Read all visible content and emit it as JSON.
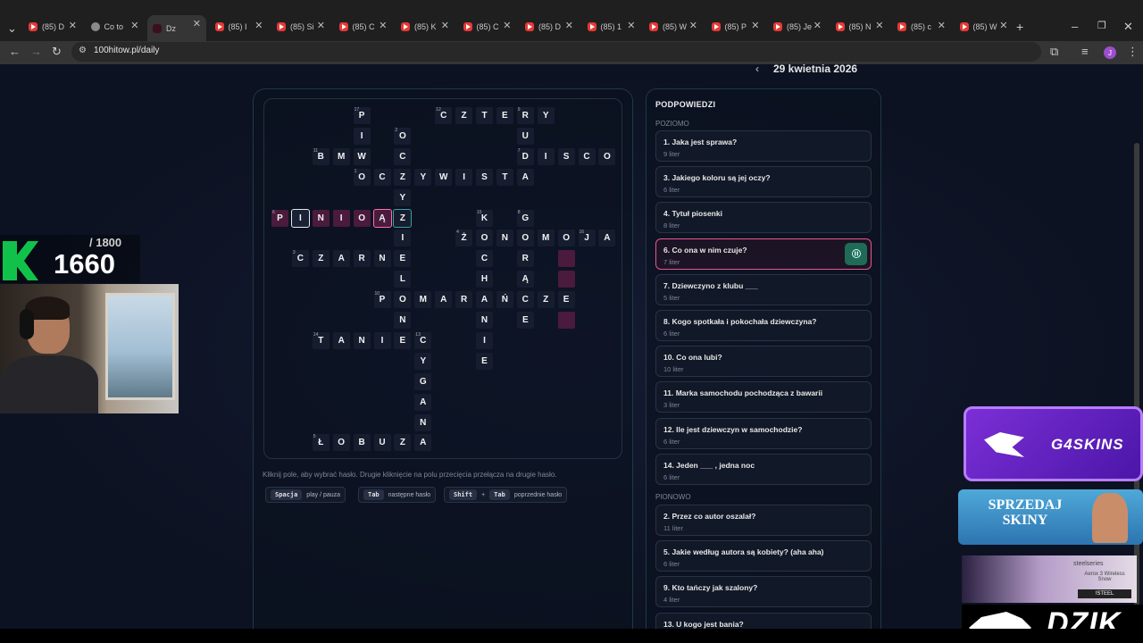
{
  "browser": {
    "tabs": [
      {
        "title": "(85) D",
        "icon": "youtube-icon"
      },
      {
        "title": "Co to",
        "icon": "globe-icon"
      },
      {
        "title": "Dz",
        "icon": "site-icon",
        "active": true
      },
      {
        "title": "(85) I",
        "icon": "youtube-icon"
      },
      {
        "title": "(85) Si",
        "icon": "youtube-icon"
      },
      {
        "title": "(85) C",
        "icon": "youtube-icon"
      },
      {
        "title": "(85) K",
        "icon": "youtube-icon"
      },
      {
        "title": "(85) C",
        "icon": "youtube-icon"
      },
      {
        "title": "(85) D",
        "icon": "youtube-icon"
      },
      {
        "title": "(85) 1",
        "icon": "youtube-icon"
      },
      {
        "title": "(85) W",
        "icon": "youtube-icon"
      },
      {
        "title": "(85) P",
        "icon": "youtube-icon"
      },
      {
        "title": "(85) Je",
        "icon": "youtube-icon"
      },
      {
        "title": "(85) N",
        "icon": "youtube-icon"
      },
      {
        "title": "(85) c",
        "icon": "youtube-icon"
      },
      {
        "title": "(85) W",
        "icon": "youtube-icon"
      }
    ],
    "url": "100hitow.pl/daily",
    "profile_initial": "J"
  },
  "header": {
    "date": "29 kwietnia 2026"
  },
  "crossword": {
    "cells": [
      {
        "c": "P",
        "r": 0,
        "col": 4,
        "n": "17"
      },
      {
        "c": "C",
        "r": 0,
        "col": 8,
        "n": "12"
      },
      {
        "c": "Z",
        "r": 0,
        "col": 9
      },
      {
        "c": "T",
        "r": 0,
        "col": 10
      },
      {
        "c": "E",
        "r": 0,
        "col": 11
      },
      {
        "c": "R",
        "r": 0,
        "col": 12,
        "n": "9"
      },
      {
        "c": "Y",
        "r": 0,
        "col": 13
      },
      {
        "c": "I",
        "r": 1,
        "col": 4
      },
      {
        "c": "O",
        "r": 1,
        "col": 6,
        "n": "2"
      },
      {
        "c": "U",
        "r": 1,
        "col": 12
      },
      {
        "c": "B",
        "r": 2,
        "col": 2,
        "n": "11"
      },
      {
        "c": "M",
        "r": 2,
        "col": 3
      },
      {
        "c": "W",
        "r": 2,
        "col": 4
      },
      {
        "c": "C",
        "r": 2,
        "col": 6
      },
      {
        "c": "D",
        "r": 2,
        "col": 12,
        "n": "7"
      },
      {
        "c": "I",
        "r": 2,
        "col": 13
      },
      {
        "c": "S",
        "r": 2,
        "col": 14
      },
      {
        "c": "C",
        "r": 2,
        "col": 15
      },
      {
        "c": "O",
        "r": 2,
        "col": 16
      },
      {
        "c": "O",
        "r": 3,
        "col": 4,
        "n": "1"
      },
      {
        "c": "C",
        "r": 3,
        "col": 5
      },
      {
        "c": "Z",
        "r": 3,
        "col": 6
      },
      {
        "c": "Y",
        "r": 3,
        "col": 7
      },
      {
        "c": "W",
        "r": 3,
        "col": 8
      },
      {
        "c": "I",
        "r": 3,
        "col": 9
      },
      {
        "c": "S",
        "r": 3,
        "col": 10
      },
      {
        "c": "T",
        "r": 3,
        "col": 11
      },
      {
        "c": "A",
        "r": 3,
        "col": 12
      },
      {
        "c": "Y",
        "r": 4,
        "col": 6
      },
      {
        "c": "P",
        "r": 5,
        "col": 0,
        "n": "6",
        "s": "hl"
      },
      {
        "c": "I",
        "r": 5,
        "col": 1,
        "s": "sel"
      },
      {
        "c": "N",
        "r": 5,
        "col": 2,
        "s": "hl"
      },
      {
        "c": "I",
        "r": 5,
        "col": 3,
        "s": "hl"
      },
      {
        "c": "O",
        "r": 5,
        "col": 4,
        "s": "hl"
      },
      {
        "c": "Ą",
        "r": 5,
        "col": 5,
        "s": "hlsel"
      },
      {
        "c": "Z",
        "r": 5,
        "col": 6,
        "s": "cross"
      },
      {
        "c": "K",
        "r": 5,
        "col": 10,
        "n": "15"
      },
      {
        "c": "G",
        "r": 5,
        "col": 12,
        "n": "8"
      },
      {
        "c": "I",
        "r": 6,
        "col": 6
      },
      {
        "c": "Ż",
        "r": 6,
        "col": 9,
        "n": "4"
      },
      {
        "c": "O",
        "r": 6,
        "col": 10
      },
      {
        "c": "N",
        "r": 6,
        "col": 11
      },
      {
        "c": "O",
        "r": 6,
        "col": 12
      },
      {
        "c": "M",
        "r": 6,
        "col": 13
      },
      {
        "c": "O",
        "r": 6,
        "col": 14
      },
      {
        "c": "J",
        "r": 6,
        "col": 15,
        "n": "16"
      },
      {
        "c": "A",
        "r": 6,
        "col": 16
      },
      {
        "c": "C",
        "r": 7,
        "col": 1,
        "n": "3"
      },
      {
        "c": "Z",
        "r": 7,
        "col": 2
      },
      {
        "c": "A",
        "r": 7,
        "col": 3
      },
      {
        "c": "R",
        "r": 7,
        "col": 4
      },
      {
        "c": "N",
        "r": 7,
        "col": 5
      },
      {
        "c": "E",
        "r": 7,
        "col": 6
      },
      {
        "c": "C",
        "r": 7,
        "col": 10
      },
      {
        "c": "R",
        "r": 7,
        "col": 12
      },
      {
        "c": "",
        "r": 7,
        "col": 14,
        "s": "empty"
      },
      {
        "c": "L",
        "r": 8,
        "col": 6
      },
      {
        "c": "H",
        "r": 8,
        "col": 10
      },
      {
        "c": "Ą",
        "r": 8,
        "col": 12
      },
      {
        "c": "",
        "r": 8,
        "col": 14,
        "s": "empty"
      },
      {
        "c": "P",
        "r": 9,
        "col": 5,
        "n": "10"
      },
      {
        "c": "O",
        "r": 9,
        "col": 6
      },
      {
        "c": "M",
        "r": 9,
        "col": 7
      },
      {
        "c": "A",
        "r": 9,
        "col": 8
      },
      {
        "c": "R",
        "r": 9,
        "col": 9
      },
      {
        "c": "A",
        "r": 9,
        "col": 10
      },
      {
        "c": "Ń",
        "r": 9,
        "col": 11
      },
      {
        "c": "C",
        "r": 9,
        "col": 12
      },
      {
        "c": "Z",
        "r": 9,
        "col": 13
      },
      {
        "c": "E",
        "r": 9,
        "col": 14
      },
      {
        "c": "N",
        "r": 10,
        "col": 6
      },
      {
        "c": "N",
        "r": 10,
        "col": 10
      },
      {
        "c": "E",
        "r": 10,
        "col": 12
      },
      {
        "c": "",
        "r": 10,
        "col": 14,
        "s": "empty"
      },
      {
        "c": "T",
        "r": 11,
        "col": 2,
        "n": "14"
      },
      {
        "c": "A",
        "r": 11,
        "col": 3
      },
      {
        "c": "N",
        "r": 11,
        "col": 4
      },
      {
        "c": "I",
        "r": 11,
        "col": 5
      },
      {
        "c": "E",
        "r": 11,
        "col": 6
      },
      {
        "c": "C",
        "r": 11,
        "col": 7,
        "n": "13"
      },
      {
        "c": "I",
        "r": 11,
        "col": 10
      },
      {
        "c": "Y",
        "r": 12,
        "col": 7
      },
      {
        "c": "E",
        "r": 12,
        "col": 10
      },
      {
        "c": "G",
        "r": 13,
        "col": 7
      },
      {
        "c": "A",
        "r": 14,
        "col": 7
      },
      {
        "c": "N",
        "r": 15,
        "col": 7
      },
      {
        "c": "Ł",
        "r": 16,
        "col": 2,
        "n": "5"
      },
      {
        "c": "O",
        "r": 16,
        "col": 3
      },
      {
        "c": "B",
        "r": 16,
        "col": 4
      },
      {
        "c": "U",
        "r": 16,
        "col": 5
      },
      {
        "c": "Z",
        "r": 16,
        "col": 6
      },
      {
        "c": "A",
        "r": 16,
        "col": 7
      }
    ],
    "hint": "Kliknij pole, aby wybrać hasło. Drugie kliknięcie na polu przecięcia przełącza na drugie hasło.",
    "shortcuts": [
      {
        "keys": [
          "Spacja"
        ],
        "label": "play / pauza"
      },
      {
        "keys": [
          "Tab"
        ],
        "label": "następne hasło"
      },
      {
        "keys": [
          "Shift",
          "Tab"
        ],
        "label": "poprzednie hasło"
      }
    ]
  },
  "clues": {
    "title": "PODPOWIEDZI",
    "across_label": "POZIOMO",
    "down_label": "PIONOWO",
    "across": [
      {
        "text": "1. Jaka jest sprawa?",
        "len": "9 liter"
      },
      {
        "text": "3. Jakiego koloru są jej oczy?",
        "len": "6 liter"
      },
      {
        "text": "4. Tytuł piosenki",
        "len": "8 liter"
      },
      {
        "text": "6. Co ona w nim czuje?",
        "len": "7 liter",
        "active": true
      },
      {
        "text": "7. Dziewczyno z klubu ___",
        "len": "5 liter"
      },
      {
        "text": "8. Kogo spotkała i pokochała dziewczyna?",
        "len": "6 liter"
      },
      {
        "text": "10. Co ona lubi?",
        "len": "10 liter"
      },
      {
        "text": "11. Marka samochodu pochodząca z bawarii",
        "len": "3 liter"
      },
      {
        "text": "12. Ile jest dziewczyn w samochodzie?",
        "len": "6 liter"
      },
      {
        "text": "14. Jeden ___ , jedna noc",
        "len": "6 liter"
      }
    ],
    "down": [
      {
        "text": "2. Przez co autor oszalał?",
        "len": "11 liter"
      },
      {
        "text": "5. Jakie według autora są kobiety? (aha aha)",
        "len": "6 liter"
      },
      {
        "text": "9. Kto tańczy jak szalony?",
        "len": "4 liter"
      },
      {
        "text": "13. U kogo jest bania?",
        "len": ""
      }
    ]
  },
  "stream_overlay": {
    "score": "1660",
    "score_max": "/ 1800",
    "ads": {
      "ad1": "G4SKINS",
      "ad2": "SPRZEDAJ SKINY",
      "ad3_brand": "steelseries",
      "ad3_product": "Aerox 3 Wireless Snow",
      "ad3_code": "!STEEL",
      "ad4": "DZIK"
    }
  },
  "colors": {
    "accent_pink": "#e85590",
    "accent_teal": "#3aa0a0",
    "play_green": "#1f6b57"
  }
}
